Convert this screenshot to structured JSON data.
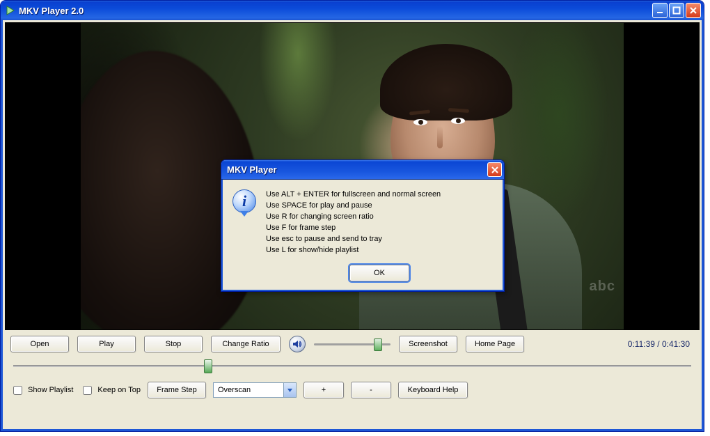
{
  "window": {
    "title": "MKV Player 2.0"
  },
  "toolbar": {
    "open": "Open",
    "play": "Play",
    "stop": "Stop",
    "change_ratio": "Change Ratio",
    "screenshot": "Screenshot",
    "home_page": "Home Page"
  },
  "time": {
    "current": "0:11:39",
    "total": "0:41:30",
    "separator": " /  "
  },
  "volume": {
    "percent": 88
  },
  "seek": {
    "percent": 28
  },
  "bottom": {
    "show_playlist": "Show Playlist",
    "keep_on_top": "Keep on Top",
    "frame_step": "Frame Step",
    "combo_value": "Overscan",
    "zoom_in": "+",
    "zoom_out": "-",
    "keyboard_help": "Keyboard Help"
  },
  "video": {
    "watermark": "abc"
  },
  "dialog": {
    "title": "MKV Player",
    "lines": [
      "Use ALT + ENTER for fullscreen and normal screen",
      "Use SPACE for play and pause",
      "Use R for changing screen ratio",
      "Use F for frame step",
      "Use esc to pause and send to tray",
      "Use L for show/hide playlist"
    ],
    "ok": "OK"
  }
}
